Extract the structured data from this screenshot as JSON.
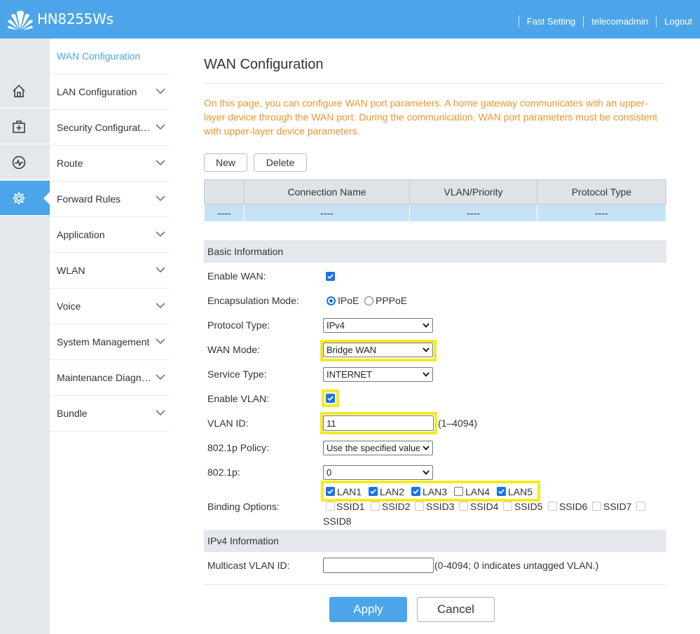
{
  "header": {
    "brand": "HN8255Ws",
    "links": [
      "Fast Setting",
      "telecomadmin",
      "Logout"
    ]
  },
  "rail": {
    "icons": [
      "home-icon",
      "first-aid-icon",
      "activity-icon",
      "gear-icon"
    ]
  },
  "nav": {
    "items": [
      {
        "label": "WAN Configuration"
      },
      {
        "label": "LAN Configuration"
      },
      {
        "label": "Security Configuration"
      },
      {
        "label": "Route"
      },
      {
        "label": "Forward Rules"
      },
      {
        "label": "Application"
      },
      {
        "label": "WLAN"
      },
      {
        "label": "Voice"
      },
      {
        "label": "System Management"
      },
      {
        "label": "Maintenance Diagnosis"
      },
      {
        "label": "Bundle"
      }
    ]
  },
  "page": {
    "title": "WAN Configuration",
    "description": "On this page, you can configure WAN port parameters. A home gateway communicates with an upper-layer device through the WAN port. During the communication, WAN port parameters must be consistent with upper-layer device parameters.",
    "new_label": "New",
    "delete_label": "Delete"
  },
  "wan_table": {
    "headers": [
      "",
      "Connection Name",
      "VLAN/Priority",
      "Protocol Type"
    ],
    "rows": [
      [
        "----",
        "----",
        "----",
        "----"
      ]
    ]
  },
  "basic": {
    "section_title": "Basic Information",
    "enable_wan_label": "Enable WAN:",
    "encap_label": "Encapsulation Mode:",
    "encap_opt1": "IPoE",
    "encap_opt2": "PPPoE",
    "protocol_label": "Protocol Type:",
    "protocol_value": "IPv4",
    "wan_mode_label": "WAN Mode:",
    "wan_mode_value": "Bridge WAN",
    "service_label": "Service Type:",
    "service_value": "INTERNET",
    "enable_vlan_label": "Enable VLAN:",
    "vlan_id_label": "VLAN ID:",
    "vlan_id_value": "11",
    "vlan_id_hint": "(1–4094)",
    "policy_label": "802.1p Policy:",
    "policy_value": "Use the specified value",
    "p_label": "802.1p:",
    "p_value": "0",
    "binding_label": "Binding Options:",
    "lan": [
      {
        "name": "LAN1",
        "checked": true
      },
      {
        "name": "LAN2",
        "checked": true
      },
      {
        "name": "LAN3",
        "checked": true
      },
      {
        "name": "LAN4",
        "checked": false
      },
      {
        "name": "LAN5",
        "checked": true
      }
    ],
    "ssid": [
      "SSID1",
      "SSID2",
      "SSID3",
      "SSID4",
      "SSID5",
      "SSID6",
      "SSID7",
      "SSID8"
    ]
  },
  "ipv4": {
    "section_title": "IPv4 Information",
    "multicast_label": "Multicast VLAN ID:",
    "multicast_value": "",
    "multicast_hint": "(0-4094; 0 indicates untagged VLAN.)"
  },
  "actions": {
    "apply_label": "Apply",
    "cancel_label": "Cancel"
  },
  "colors": {
    "header": "#4ba5e8",
    "accent": "#4ba5e8",
    "description": "#e8962e",
    "highlight": "#f5ea22",
    "table_row": "#c6e2f7"
  }
}
